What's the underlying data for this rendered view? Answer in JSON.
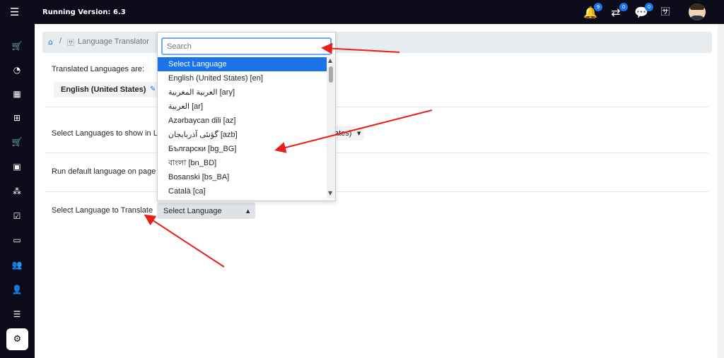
{
  "topbar": {
    "version_text": "Running Version: 6.3",
    "icons": [
      {
        "name": "bell-icon",
        "badge": "9"
      },
      {
        "name": "exchange-icon",
        "badge": "0"
      },
      {
        "name": "chat-icon",
        "badge": "0"
      },
      {
        "name": "translate-icon",
        "badge": ""
      }
    ]
  },
  "sidebar": {
    "items": [
      {
        "icon": "cart-icon"
      },
      {
        "icon": "dashboard-icon"
      },
      {
        "icon": "calendar-icon"
      },
      {
        "icon": "calendar-plus-icon"
      },
      {
        "icon": "cart-icon"
      },
      {
        "icon": "briefcase-icon"
      },
      {
        "icon": "cubes-icon"
      },
      {
        "icon": "calendar-check-icon"
      },
      {
        "icon": "money-icon"
      },
      {
        "icon": "users-icon"
      },
      {
        "icon": "user-icon"
      },
      {
        "icon": "list-icon"
      },
      {
        "icon": "cogs-icon"
      }
    ]
  },
  "breadcrumb": {
    "page": "Language Translator"
  },
  "main": {
    "translated_label": "Translated Languages are:",
    "translated_pill": "English (United States)",
    "show_label": "Select Languages to show in L",
    "show_select_partial": "ates)",
    "default_label": "Run default language on page",
    "translate_label": "Select Language to Translate",
    "translate_select": "Select Language"
  },
  "dropdown": {
    "search_placeholder": "Search",
    "options": [
      {
        "label": "Select Language",
        "selected": true
      },
      {
        "label": "English (United States) [en]",
        "selected": false
      },
      {
        "label": "العربية المغربية [ary]",
        "selected": false
      },
      {
        "label": "العربية [ar]",
        "selected": false
      },
      {
        "label": "Azərbaycan dili [az]",
        "selected": false
      },
      {
        "label": "گؤنئی آذربایجان [azb]",
        "selected": false
      },
      {
        "label": "Български [bg_BG]",
        "selected": false
      },
      {
        "label": "বাংলা [bn_BD]",
        "selected": false
      },
      {
        "label": "Bosanski [bs_BA]",
        "selected": false
      },
      {
        "label": "Català [ca]",
        "selected": false
      }
    ]
  },
  "colors": {
    "dark": "#0b0b1a",
    "accent": "#1a73e8",
    "arrow": "#e8201a"
  }
}
